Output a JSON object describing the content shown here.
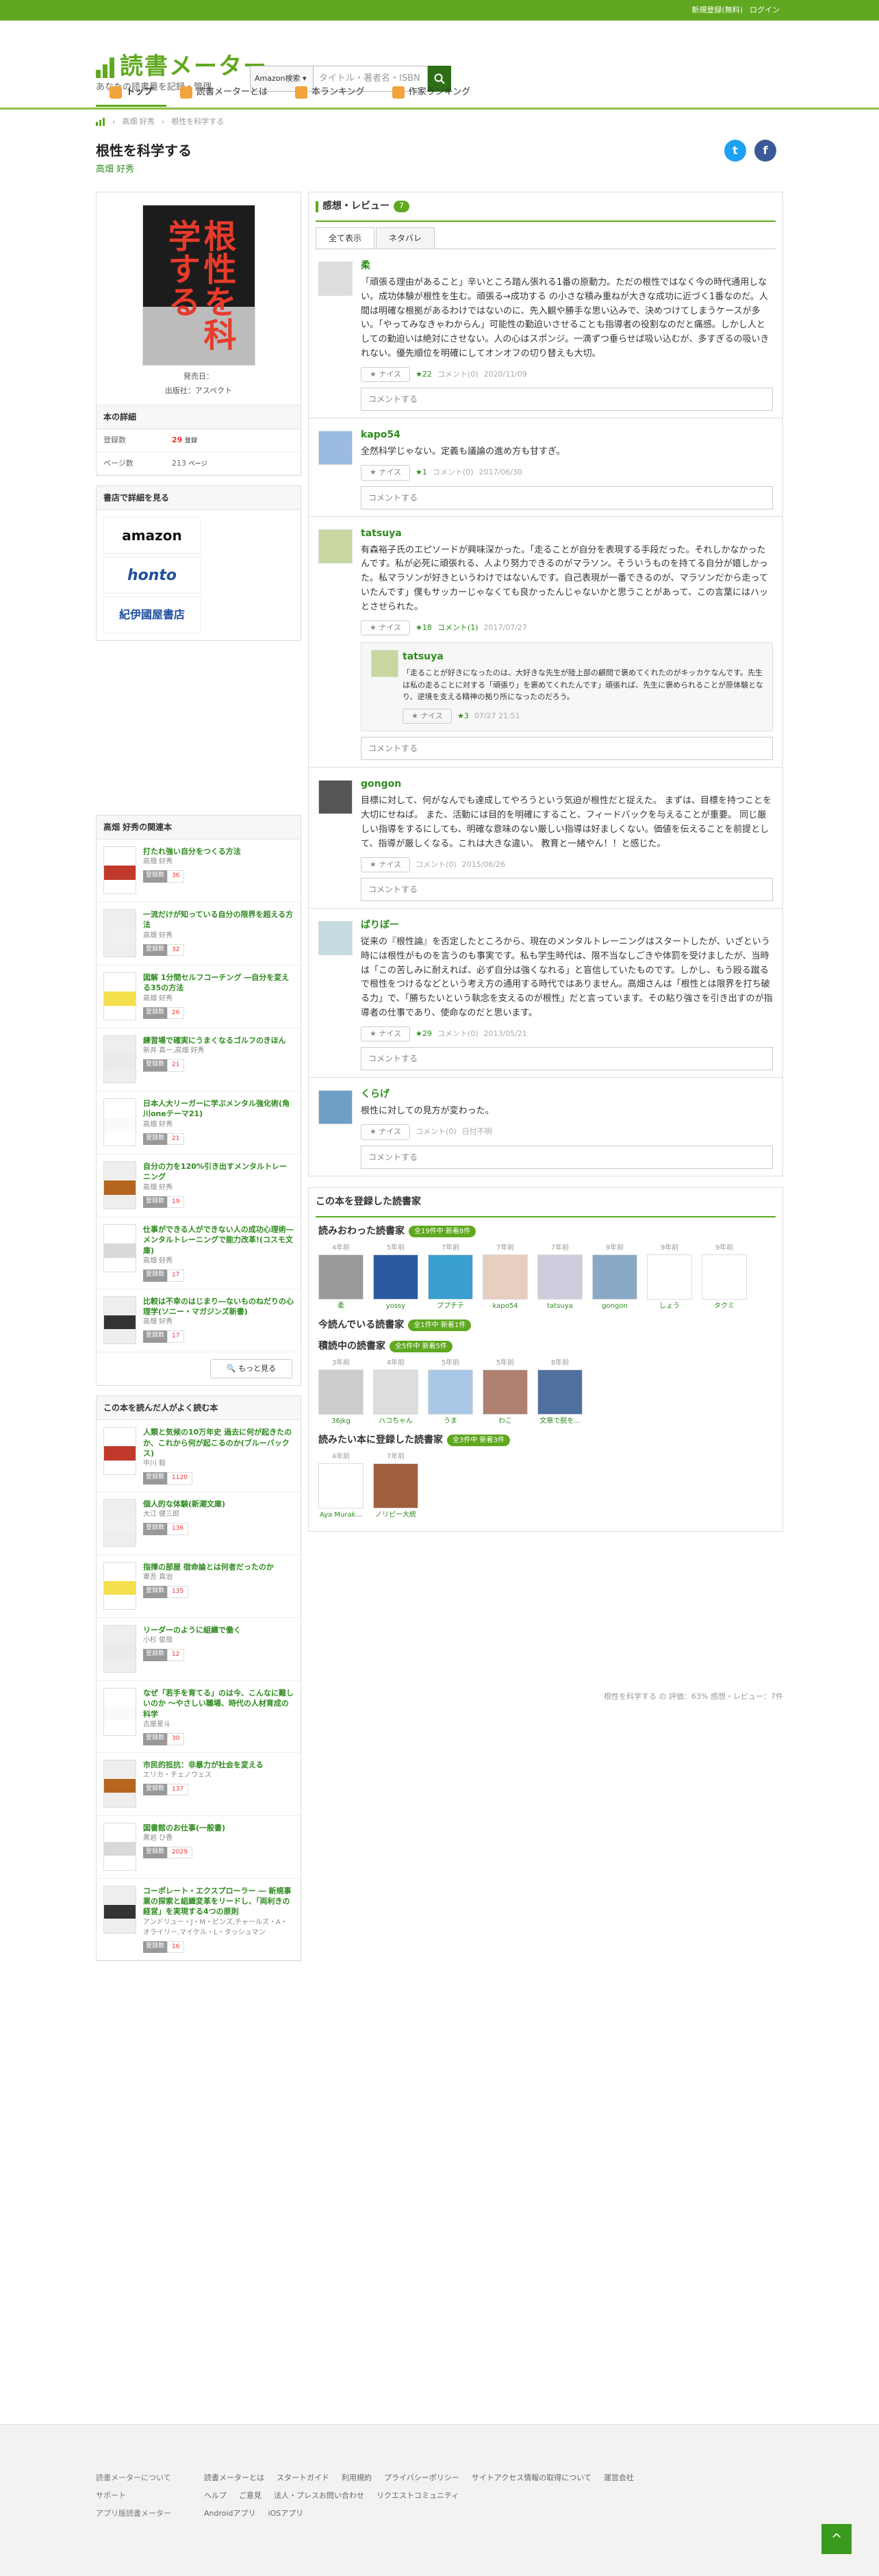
{
  "topbar": {
    "register": "新規登録(無料)",
    "login": "ログイン"
  },
  "logo": {
    "title": "読書メーター",
    "subtitle": "あなたの読書量を記録・管理"
  },
  "search": {
    "select": "Amazon検索",
    "placeholder": "タイトル・著者名・ISBN"
  },
  "nav": [
    "トップ",
    "読書メーターとは",
    "本ランキング",
    "作家ランキング"
  ],
  "breadcrumbs": [
    "高畑 好秀",
    "根性を科学する"
  ],
  "book": {
    "title": "根性を科学する",
    "author": "高畑 好秀",
    "publisher_line": "発売日：",
    "publisher": "出版社：アスペクト",
    "details_heading": "本の詳細",
    "registered_label": "登録数",
    "registered": "29",
    "registered_unit": "登録",
    "pages_label": "ページ数",
    "pages": "213",
    "pages_unit": "ページ",
    "stores_heading": "書店で詳細を見る",
    "stores": [
      "amazon",
      "honto",
      "紀伊國屋書店"
    ],
    "cover_text": "根性を科学する"
  },
  "related": {
    "heading": "高畑 好秀の関連本",
    "more": "もっと見る",
    "items": [
      {
        "title": "打たれ強い自分をつくる方法",
        "author": "高畑 好秀",
        "count": "36"
      },
      {
        "title": "一流だけが知っている自分の限界を超える方法",
        "author": "高畑 好秀",
        "count": "32"
      },
      {
        "title": "図解 1分間セルフコーチング ―自分を変える35の方法",
        "author": "高畑 好秀",
        "count": "26"
      },
      {
        "title": "練習場で確実にうまくなるゴルフのきほん",
        "author": "新井 真一,高畑 好秀",
        "count": "21"
      },
      {
        "title": "日本人大リーガーに学ぶメンタル強化術(角川oneテーマ21)",
        "author": "高畑 好秀",
        "count": "21"
      },
      {
        "title": "自分の力を120%引き出すメンタルトレーニング",
        "author": "高畑 好秀",
        "count": "19"
      },
      {
        "title": "仕事ができる人ができない人の成功心理術―メンタルトレーニングで能力改革!(コスモ文庫)",
        "author": "高畑 好秀",
        "count": "17"
      },
      {
        "title": "比較は不幸のはじまり―ないものねだりの心理学(ソニー・マガジンズ新書)",
        "author": "高畑 好秀",
        "count": "17"
      }
    ]
  },
  "also_read": {
    "heading": "この本を読んだ人がよく読む本",
    "items": [
      {
        "title": "人類と気候の10万年史 過去に何が起きたのか、これから何が起こるのか(ブルーバックス)",
        "author": "中川 毅",
        "count": "1120"
      },
      {
        "title": "個人的な体験(新潮文庫)",
        "author": "大江 健三郎",
        "count": "136"
      },
      {
        "title": "指揮の部屋 宿命論とは何者だったのか",
        "author": "東吾 真治",
        "count": "135"
      },
      {
        "title": "リーダーのように組織で働く",
        "author": "小杉 俊哉",
        "count": "12"
      },
      {
        "title": "なぜ「若手を育てる」のは今、こんなに難しいのか ～やさしい職場、時代の人材育成の科学",
        "author": "古屋星斗",
        "count": "30"
      },
      {
        "title": "市民的抵抗：非暴力が社会を変える",
        "author": "エリカ・チェノウェス",
        "count": "137"
      },
      {
        "title": "図書館のお仕事(一般書)",
        "author": "黒岩 ひ香",
        "count": "2029"
      },
      {
        "title": "コーポレート・エクスプローラー ― 新規事業の探索と組織変革をリードし、「両利きの経営」を実現する4つの原則",
        "author": "アンドリュー・J・M・ビンズ,チャールズ・A・オライリー,マイケル・L・タッシュマン",
        "count": "16"
      }
    ]
  },
  "reviews": {
    "heading": "感想・レビュー",
    "count": "7",
    "tabs": [
      "全て表示",
      "ネタバレ"
    ],
    "nice_label": "ナイス",
    "comment_label": "コメント",
    "comment_placeholder": "コメントする",
    "items": [
      {
        "user": "柔",
        "text": "「頑張る理由があること」辛いところ踏ん張れる1番の原動力。ただの根性ではなく今の時代通用しない。成功体験が根性を生む。頑張る→成功する の小さな積み重ねが大きな成功に近づく1番なのだ。人間は明確な根拠があるわけではないのに、先入観や勝手な思い込みで、決めつけてしまうケースが多い。「やってみなきゃわからん」可能性の勤迫いさせることも指導者の役割なのだと痛感。しかし人としての勤迫いは絶対にさせない。人の心はスポンジ。一滴ずつ垂らせば吸い込むが、多すぎるの吸いきれない。優先順位を明確にしてオンオフの切り替えも大切。",
        "nice": "22",
        "comments": "コメント(0)",
        "date": "2020/11/09"
      },
      {
        "user": "kapo54",
        "text": "全然科学じゃない。定義も議論の進め方も甘すぎ。",
        "nice": "1",
        "comments": "コメント(0)",
        "date": "2017/06/30"
      },
      {
        "user": "tatsuya",
        "text": "有森裕子氏のエピソードが興味深かった。「走ることが自分を表現する手段だった。それしかなかったんです。私が必死に頑張れる、人より努力できるのがマラソン。そういうものを持てる自分が嬉しかった。私マラソンが好きというわけではないんです。自己表現が一番できるのが、マラソンだから走っていたんです」僕もサッカーじゃなくても良かったんじゃないかと思うことがあって、この言葉にはハッとさせられた。",
        "nice": "18",
        "comments": "コメント(1)",
        "date": "2017/07/27",
        "reply": {
          "user": "tatsuya",
          "text": "「走ることが好きになったのは、大好きな先生が陸上部の顧問で褒めてくれたのがキッカケなんです。先生は私の走ることに対する「頑張り」を褒めてくれたんです」頑張れば、先生に褒められることが原体験となり、逆境を支える精神の拠り所になったのだろう。",
          "nice": "3",
          "date": "07/27 21:51"
        }
      },
      {
        "user": "gongon",
        "text": "目標に対して、何がなんでも達成してやろうという気迫が根性だと捉えた。 まずは、目標を持つことを大切にせねば。 また、活動には目的を明確にすること、フィードバックを与えることが重要。 同じ厳しい指導をするにしても、明確な意味のない厳しい指導は好ましくない。価値を伝えることを前提として、指導が厳しくなる。これは大きな違い。 教育と一緒やん！！と感じた。",
        "nice": "",
        "comments": "コメント(0)",
        "date": "2015/06/26"
      },
      {
        "user": "ばりぼー",
        "text": "従来の『根性論』を否定したところから、現在のメンタルトレーニングはスタートしたが、いざという時には根性がものを言うのも事実です。私も学生時代は、限不当なしごきや体罰を受けましたが、当時は「この苦しみに耐えれば、必ず自分は強くなれる」と盲信していたものです。しかし、もう殴る蹴るで根性をつけるなどという考え方の通用する時代ではありません。高畑さんは「根性とは限界を打ち破る力」で、「勝ちたいという執念を支えるのが根性」だと言っています。その粘り強さを引き出すのが指導者の仕事であり、使命なのだと思います。",
        "nice": "29",
        "comments": "コメント(0)",
        "date": "2013/05/21"
      },
      {
        "user": "くらげ",
        "text": "根性に対しての見方が変わった。",
        "nice": "",
        "comments": "コメント(0)",
        "date": "日付不明"
      }
    ]
  },
  "registered_readers": {
    "heading": "この本を登録した読書家",
    "sections": [
      {
        "title": "読みおわった読書家",
        "badge": "全19件中 新着8件",
        "users": [
          {
            "ago": "4年前",
            "name": "柔"
          },
          {
            "ago": "5年前",
            "name": "yossy"
          },
          {
            "ago": "7年前",
            "name": "ププチテ"
          },
          {
            "ago": "7年前",
            "name": "kapo54"
          },
          {
            "ago": "7年前",
            "name": "tatsuya"
          },
          {
            "ago": "9年前",
            "name": "gongon"
          },
          {
            "ago": "9年前",
            "name": "しょう"
          },
          {
            "ago": "9年前",
            "name": "タクミ"
          }
        ]
      },
      {
        "title": "今読んでいる読書家",
        "badge": "全1件中 新着1件",
        "users": []
      },
      {
        "title": "積読中の読書家",
        "badge": "全5件中 新着5件",
        "users": [
          {
            "ago": "3年前",
            "name": "36jkg"
          },
          {
            "ago": "4年前",
            "name": "ハコちゃん"
          },
          {
            "ago": "5年前",
            "name": "うま"
          },
          {
            "ago": "5年前",
            "name": "わこ"
          },
          {
            "ago": "8年前",
            "name": "文章で脱を..."
          }
        ]
      },
      {
        "title": "読みたい本に登録した読書家",
        "badge": "全3件中 新着3件",
        "users": [
          {
            "ago": "4年前",
            "name": "Aya Murak..."
          },
          {
            "ago": "7年前",
            "name": "ノリピー大統"
          }
        ]
      }
    ]
  },
  "summary": "根性を科学する の 評価：63% 感想・レビュー：7件",
  "footer": {
    "row1_head": "読書メーターについて",
    "row1": [
      "読書メーターとは",
      "スタートガイド",
      "利用規約",
      "プライバシーポリシー",
      "サイトアクセス情報の取得について",
      "運営会社"
    ],
    "row2_head": "サポート",
    "row2": [
      "ヘルプ",
      "ご意見",
      "法人・プレスお問い合わせ",
      "リクエストコミュニティ"
    ],
    "row3_head": "アプリ版読書メーター",
    "row3": [
      "Androidアプリ",
      "iOSアプリ"
    ]
  },
  "colors": {
    "brand": "#5fa81f",
    "link": "#2e8b1e",
    "accent": "#e33b2b"
  }
}
